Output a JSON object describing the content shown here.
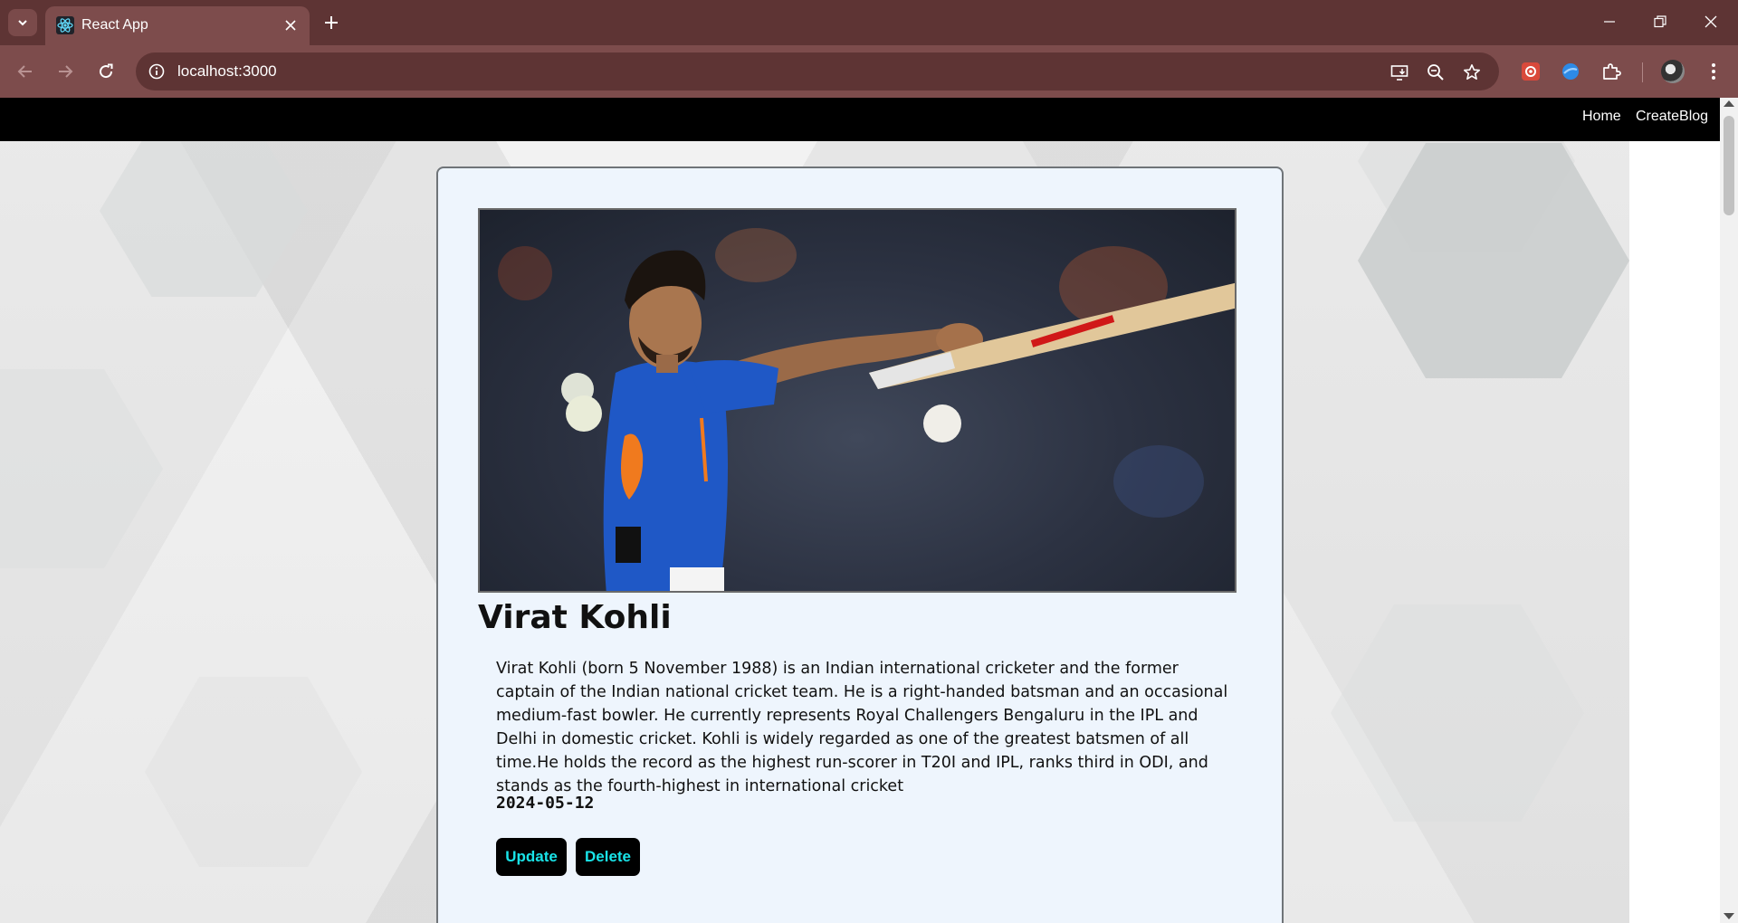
{
  "browser": {
    "tab_title": "React App",
    "url": "localhost:3000"
  },
  "navbar": {
    "links": [
      "Home",
      "CreateBlog"
    ]
  },
  "post": {
    "title": "Virat Kohli",
    "body": "Virat Kohli (born 5 November 1988) is an Indian international cricketer and the former captain of the Indian national cricket team. He is a right-handed batsman and an occasional medium-fast bowler. He currently represents Royal Challengers Bengaluru in the IPL and Delhi in domestic cricket. Kohli is widely regarded as one of the greatest batsmen of all time.He holds the record as the highest run-scorer in T20I and IPL, ranks third in ODI, and stands as the fourth-highest in international cricket",
    "date": "2024-05-12",
    "update_label": "Update",
    "delete_label": "Delete"
  },
  "colors": {
    "chrome_dark": "#5e3434",
    "chrome_light": "#7d4c4c",
    "card_bg": "#eef5fd",
    "button_text": "#19e3e8"
  }
}
